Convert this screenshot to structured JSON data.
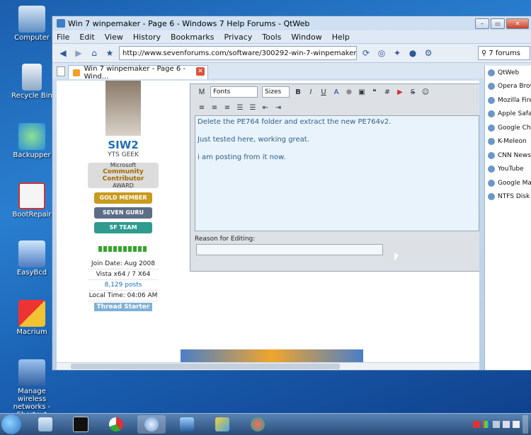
{
  "desktop": {
    "icons": [
      {
        "label": "Computer"
      },
      {
        "label": "Recycle Bin"
      },
      {
        "label": "Backupper"
      },
      {
        "label": "BootRepair"
      },
      {
        "label": "EasyBcd"
      },
      {
        "label": "Macrium"
      },
      {
        "label": "Manage wireless networks - Shortcut"
      }
    ]
  },
  "window": {
    "title": "Win 7 winpemaker - Page 6 - Windows 7 Help Forums - QtWeb",
    "menu": [
      "File",
      "Edit",
      "View",
      "History",
      "Bookmarks",
      "Privacy",
      "Tools",
      "Window",
      "Help"
    ],
    "url": "http://www.sevenforums.com/software/300292-win-7-winpemaker-6.html#po:",
    "search_placeholder": "7 forums",
    "tab_title": "Win 7 winpemaker - Page 6 - Wind..."
  },
  "sidebar": {
    "items": [
      "QtWeb",
      "Opera Browser",
      "Mozilla Firefox",
      "Apple Safari",
      "Google Chrome",
      "K-Meleon",
      "CNN News",
      "YouTube",
      "Google Maps",
      "NTFS Disk T"
    ]
  },
  "profile": {
    "username": "SIW2",
    "user_title": "YTS GEEK",
    "award_line1": "Microsoft",
    "award_line2": "Community Contributor",
    "award_line3": "AWARD",
    "badges": [
      "GOLD MEMBER",
      "SEVEN GURU",
      "SF TEAM"
    ],
    "join_date": "Join Date: Aug 2008",
    "os": "Vista x64 / 7 X64",
    "posts": "8,129 posts",
    "local_time": "Local Time: 04:06 AM",
    "thread_starter": "Thread Starter"
  },
  "editor": {
    "fonts_label": "Fonts",
    "sizes_label": "Sizes",
    "line1": "Delete the PE764 folder and extract the new PE764v2.",
    "line2": "Just tested here, working great.",
    "line3": "i am posting from it now.",
    "reason_label": "Reason for Editing:"
  },
  "colors": {
    "accent": "#1d6fb8",
    "gold": "#c89a1e",
    "guru": "#5d6d87",
    "team": "#2f9a8f"
  }
}
